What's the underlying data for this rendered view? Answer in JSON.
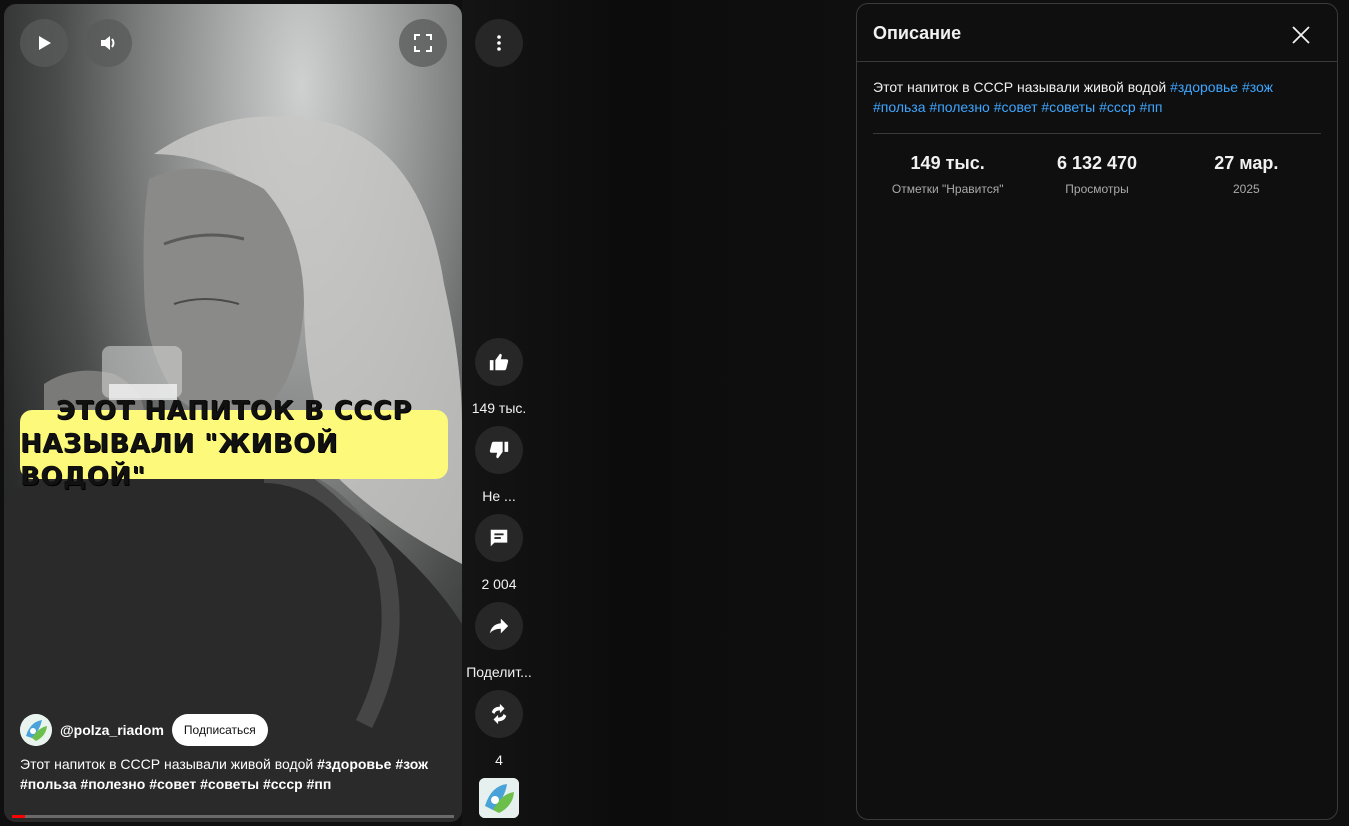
{
  "video": {
    "caption_line1": "ЭТОТ НАПИТОК В СССР",
    "caption_line2": "НАЗЫВАЛИ \"ЖИВОЙ ВОДОЙ\"",
    "channel_handle": "@polza_riadom",
    "subscribe_label": "Подписаться",
    "description_text": "Этот напиток в СССР называли живой водой",
    "hashtags_line1": [
      "#здоровье",
      "#зож"
    ],
    "hashtags_line2": [
      "#польза",
      "#полезно",
      "#совет",
      "#советы",
      "#ссср",
      "#пп"
    ],
    "progress_fraction": 0.03
  },
  "actions": {
    "like_count": "149 тыс.",
    "dislike_label": "Не ...",
    "comments_count": "2 004",
    "share_label": "Поделит...",
    "remix_count": "4"
  },
  "panel": {
    "title": "Описание",
    "description_text": "Этот напиток в СССР называли живой водой",
    "hashtags_line1": [
      "#здоровье",
      "#зож"
    ],
    "hashtags_line2": [
      "#польза",
      "#полезно",
      "#совет",
      "#советы",
      "#ссср",
      "#пп"
    ],
    "stats": [
      {
        "value": "149 тыс.",
        "label": "Отметки \"Нравится\""
      },
      {
        "value": "6 132 470",
        "label": "Просмотры"
      },
      {
        "value": "27 мар.",
        "label": "2025"
      }
    ]
  },
  "colors": {
    "hashtag_link": "#3ea6ff",
    "caption_bg": "#fdf97a",
    "progress": "#ff0000"
  },
  "icons": [
    "play-icon",
    "volume-icon",
    "fullscreen-icon",
    "more-vert-icon",
    "thumb-up-icon",
    "thumb-down-icon",
    "comment-icon",
    "share-icon",
    "remix-icon",
    "close-icon"
  ]
}
